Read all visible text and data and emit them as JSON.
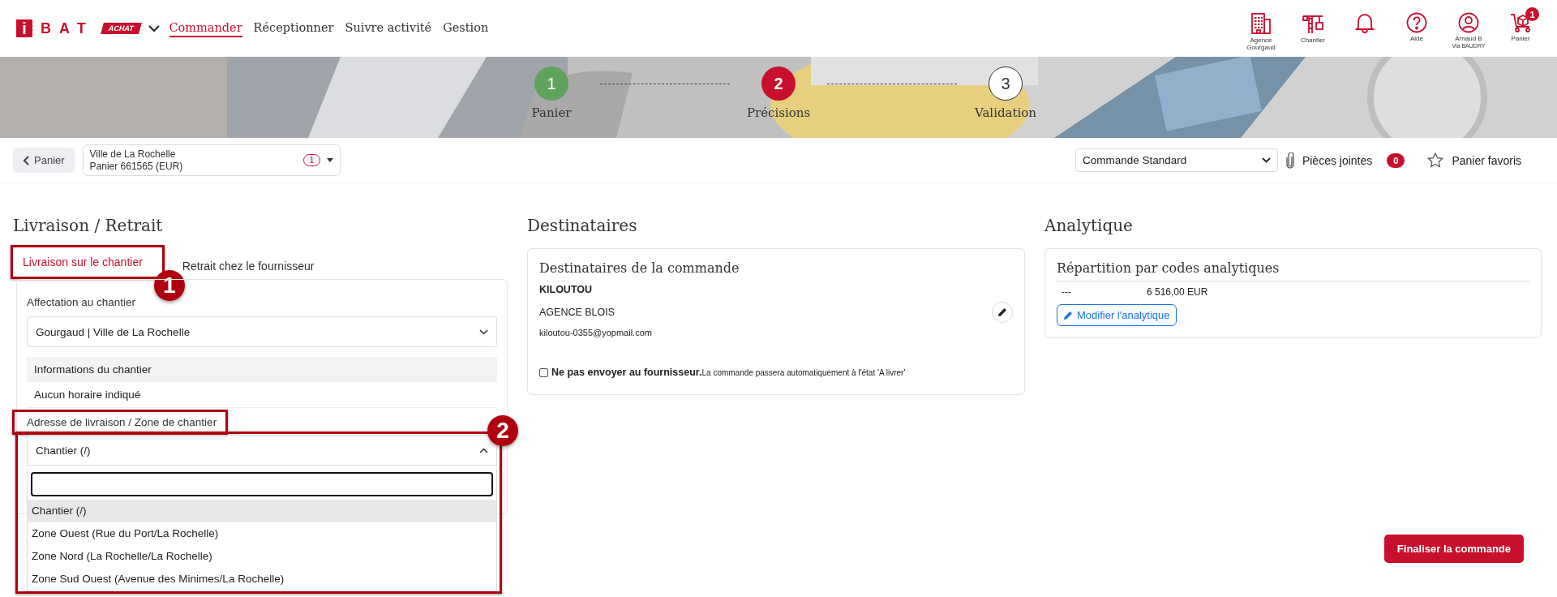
{
  "header": {
    "logo": {
      "mark": "i",
      "name": "BAT",
      "tag": "ACHAT"
    },
    "nav": [
      {
        "label": "Commander",
        "selected": true
      },
      {
        "label": "Réceptionner",
        "selected": false
      },
      {
        "label": "Suivre activité",
        "selected": false
      },
      {
        "label": "Gestion",
        "selected": false
      }
    ],
    "shortcuts": [
      {
        "kind": "building",
        "label": "Agence Gourgaud"
      },
      {
        "kind": "crane",
        "label": "Chantier"
      },
      {
        "kind": "bell"
      },
      {
        "kind": "help",
        "label": "Aide"
      },
      {
        "kind": "user",
        "label": "Arnaud B",
        "sublabel": "Via BAUDRY"
      },
      {
        "kind": "cart",
        "label": "Panier",
        "badge": "1"
      }
    ]
  },
  "steps": [
    {
      "number": "1",
      "label": "Panier",
      "kind": "done"
    },
    {
      "number": "2",
      "label": "Précisions",
      "kind": "current"
    },
    {
      "number": "3",
      "label": "Validation",
      "kind": "todo"
    }
  ],
  "toolbar": {
    "back": "Panier",
    "basket": {
      "line1": "Ville de La Rochelle",
      "line2": "Panier 661565 (EUR)",
      "count": "1"
    },
    "order_type": "Commande Standard",
    "attachments": {
      "label": "Pièces jointes",
      "count": "0"
    },
    "favorites": "Panier favoris"
  },
  "delivery": {
    "title": "Livraison / Retrait",
    "tabs": [
      {
        "label": "Livraison sur le chantier",
        "selected": true,
        "annotation": "1"
      },
      {
        "label": "Retrait chez le fournisseur",
        "selected": false
      }
    ],
    "site_label": "Affectation au chantier",
    "site_value": "Gourgaud | Ville de La Rochelle",
    "info_title": "Informations du chantier",
    "info_text": "Aucun horaire indiqué",
    "address_label": "Adresse de livraison / Zone de chantier",
    "address_highlighted": true,
    "address": {
      "value": "Chantier (/)",
      "expanded": true,
      "annotation": "2",
      "options": [
        {
          "label": "Chantier (/)",
          "selected": true
        },
        {
          "label": "Zone Ouest (Rue du Port/La Rochelle)",
          "selected": false
        },
        {
          "label": "Zone Nord (La Rochelle/La Rochelle)",
          "selected": false
        },
        {
          "label": "Zone Sud Ouest (Avenue des Minimes/La Rochelle)",
          "selected": false
        }
      ]
    }
  },
  "recipients": {
    "title": "Destinataires",
    "card_title": "Destinataires de la commande",
    "company": "KILOUTOU",
    "agency": "AGENCE BLOIS",
    "email": "kiloutou-0355@yopmail.com",
    "no_send": {
      "checked": false,
      "text": "**Ne pas envoyer au fournisseur.**La commande passera automatiquement à l'état 'A livrer'"
    }
  },
  "analytics": {
    "title": "Analytique",
    "card_title": "Répartition par codes analytiques",
    "rows": [
      {
        "code": "---",
        "amount": "6 516,00 EUR"
      }
    ],
    "edit": "Modifier l'analytique"
  },
  "finalize": "Finaliser la commande"
}
